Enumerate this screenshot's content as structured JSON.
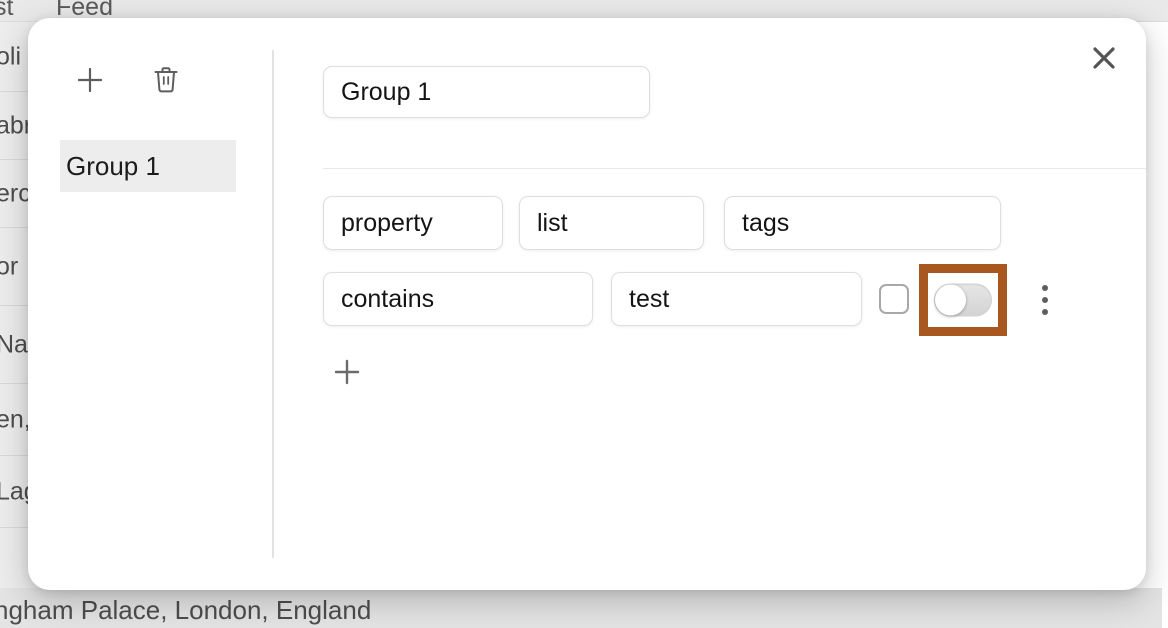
{
  "background": {
    "tabs": [
      "st",
      "Feed"
    ],
    "table_rows": [
      {
        "text": "oli"
      },
      {
        "text": "abr"
      },
      {
        "text": "erc"
      },
      {
        "text": "or "
      },
      {
        "text": "Na"
      },
      {
        "text": "en,"
      },
      {
        "text": "Lag"
      }
    ],
    "bottom_text": "ngham Palace, London, England"
  },
  "modal": {
    "close_icon": "close-icon",
    "sidebar": {
      "add_icon": "plus-icon",
      "delete_icon": "trash-icon",
      "groups": [
        {
          "label": "Group 1",
          "selected": true
        }
      ]
    },
    "content": {
      "title_value": "Group 1",
      "rules": [
        {
          "fields": [
            {
              "name": "property",
              "value": "property"
            },
            {
              "name": "list",
              "value": "list"
            },
            {
              "name": "tags",
              "value": "tags"
            }
          ]
        },
        {
          "fields": [
            {
              "name": "operator",
              "value": "contains"
            },
            {
              "name": "value",
              "value": "test"
            }
          ],
          "checkbox_checked": false,
          "toggle_on": false,
          "toggle_highlighted": true,
          "menu_icon": "kebab-menu-icon"
        }
      ],
      "add_rule_icon": "plus-icon"
    }
  },
  "colors": {
    "highlight": "#a8571f",
    "modal_bg": "#ffffff",
    "selected_item_bg": "#ededed",
    "field_border": "#dedede",
    "toggle_track_off": "#d8d8d8"
  }
}
